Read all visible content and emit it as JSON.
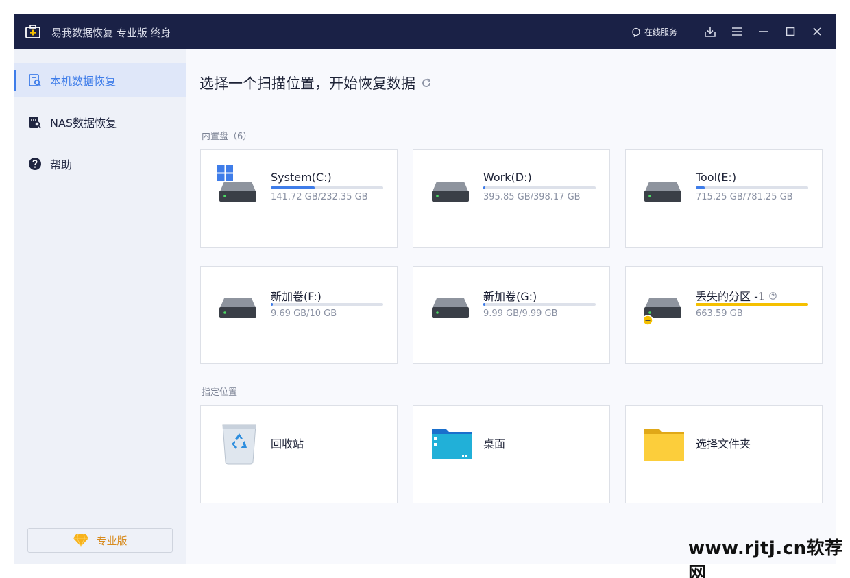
{
  "app": {
    "title": "易我数据恢复 专业版 终身",
    "online_service": "在线服务"
  },
  "sidebar": {
    "items": [
      {
        "label": "本机数据恢复",
        "active": true
      },
      {
        "label": "NAS数据恢复",
        "active": false
      },
      {
        "label": "帮助",
        "active": false
      }
    ],
    "pro_label": "专业版"
  },
  "main": {
    "title": "选择一个扫描位置，开始恢复数据",
    "internal_label": "内置盘（6）",
    "location_label": "指定位置"
  },
  "drives": [
    {
      "name": "System(C:)",
      "size": "141.72 GB/232.35 GB",
      "fill": 0.39,
      "color": "#3f7de9"
    },
    {
      "name": "Work(D:)",
      "size": "395.85 GB/398.17 GB",
      "fill": 0.02,
      "color": "#3f7de9"
    },
    {
      "name": "Tool(E:)",
      "size": "715.25 GB/781.25 GB",
      "fill": 0.08,
      "color": "#3f7de9"
    },
    {
      "name": "新加卷(F:)",
      "size": "9.69 GB/10 GB",
      "fill": 0.02,
      "color": "#3f7de9"
    },
    {
      "name": "新加卷(G:)",
      "size": "9.99 GB/9.99 GB",
      "fill": 0.02,
      "color": "#3f7de9"
    },
    {
      "name": "丢失的分区 -1",
      "size": "663.59 GB",
      "fill": 1.0,
      "color": "#f5c000"
    }
  ],
  "locations": [
    {
      "name": "回收站"
    },
    {
      "name": "桌面"
    },
    {
      "name": "选择文件夹"
    }
  ],
  "watermark": "www.rjtj.cn软荐网"
}
